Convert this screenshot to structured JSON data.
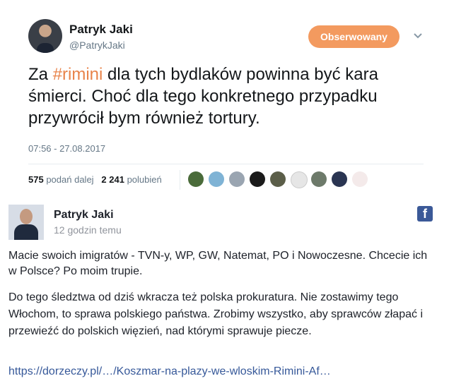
{
  "tweet": {
    "name": "Patryk Jaki",
    "handle": "@PatrykJaki",
    "follow_label": "Obserwowany",
    "text_before": "Za ",
    "hashtag": "#rimini",
    "text_after": " dla tych bydlaków powinna być kara śmierci. Choć dla tego konkretnego przypadku przywrócił bym również tortury.",
    "timestamp": "07:56 - 27.08.2017",
    "retweets_count": "575",
    "retweets_label": "podań dalej",
    "likes_count": "2 241",
    "likes_label": "polubień",
    "liker_avatars": [
      "avatar-1",
      "avatar-2",
      "avatar-3",
      "avatar-4",
      "avatar-5",
      "avatar-6",
      "avatar-7",
      "avatar-8",
      "avatar-9"
    ],
    "accent_color": "#f39a5f"
  },
  "facebook_post": {
    "name": "Patryk Jaki",
    "time": "12 godzin temu",
    "paragraph1": "Macie swoich imigratów - TVN-y, WP, GW, Natemat, PO i Nowoczesne. Chcecie ich w Polsce? Po moim trupie.",
    "paragraph2": "Do tego śledztwa od dziś wkracza też polska prokuratura. Nie zostawimy tego Włochom, to sprawa polskiego państwa. Zrobimy wszystko, aby sprawców złapać i przewieźć do polskich więzień, nad którymi sprawuje piecze.",
    "link": "https://dorzeczy.pl/…/Koszmar-na-plazy-we-wloskim-Rimini-Af…",
    "logo_letter": "f",
    "brand_color": "#3b5998"
  }
}
